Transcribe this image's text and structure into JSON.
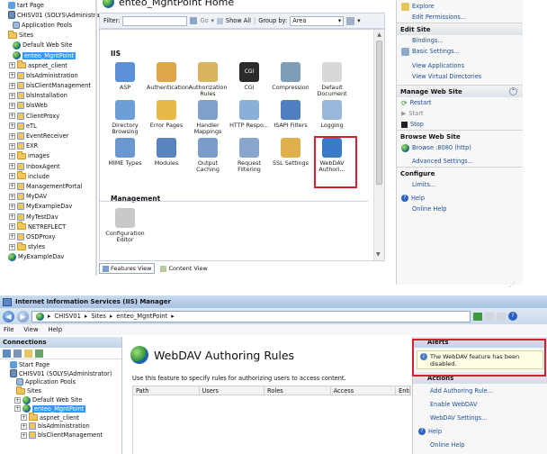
{
  "top_window": {
    "tree": [
      {
        "label": "tart Page",
        "depth": 0,
        "icon": "start-page-icon"
      },
      {
        "label": "CHISV01 (SOLYS\\Administrator)",
        "depth": 0,
        "icon": "server-icon"
      },
      {
        "label": "Application Pools",
        "depth": 1,
        "icon": "app-pools-icon"
      },
      {
        "label": "Sites",
        "depth": 0,
        "icon": "folder-icon"
      },
      {
        "label": "Default Web Site",
        "depth": 1,
        "icon": "globe-icon"
      },
      {
        "label": "enteo_MgntPoint",
        "depth": 1,
        "icon": "globe-icon",
        "selected": true
      },
      {
        "label": "aspnet_client",
        "depth": 2,
        "icon": "folder-icon"
      },
      {
        "label": "blsAdministration",
        "depth": 2,
        "icon": "app-icon"
      },
      {
        "label": "blsClientManagement",
        "depth": 2,
        "icon": "app-icon"
      },
      {
        "label": "blsInstallation",
        "depth": 2,
        "icon": "app-icon"
      },
      {
        "label": "blsWeb",
        "depth": 2,
        "icon": "app-icon"
      },
      {
        "label": "ClientProxy",
        "depth": 2,
        "icon": "app-icon"
      },
      {
        "label": "eTL",
        "depth": 2,
        "icon": "app-icon"
      },
      {
        "label": "EventReceiver",
        "depth": 2,
        "icon": "app-icon"
      },
      {
        "label": "EXR",
        "depth": 2,
        "icon": "app-icon"
      },
      {
        "label": "images",
        "depth": 2,
        "icon": "folder-icon"
      },
      {
        "label": "InboxAgent",
        "depth": 2,
        "icon": "app-icon"
      },
      {
        "label": "include",
        "depth": 2,
        "icon": "folder-icon"
      },
      {
        "label": "ManagementPortal",
        "depth": 2,
        "icon": "app-icon"
      },
      {
        "label": "MyDAV",
        "depth": 2,
        "icon": "app-icon"
      },
      {
        "label": "MyExampleDav",
        "depth": 2,
        "icon": "app-icon"
      },
      {
        "label": "MyTestDav",
        "depth": 2,
        "icon": "app-icon"
      },
      {
        "label": "NETREFLECT",
        "depth": 2,
        "icon": "folder-icon"
      },
      {
        "label": "OSDProxy",
        "depth": 2,
        "icon": "app-icon"
      },
      {
        "label": "styles",
        "depth": 2,
        "icon": "folder-icon"
      },
      {
        "label": "MyExampleDav",
        "depth": 0,
        "icon": "globe-icon"
      }
    ],
    "page_title": "enteo_MgntPoint Home",
    "filter_label": "Filter:",
    "go_label": "Go",
    "show_all_label": "Show All",
    "group_by_label": "Group by:",
    "group_by_value": "Area",
    "section_iis": "IIS",
    "section_management": "Management",
    "features": [
      {
        "label": "ASP",
        "icon": "asp-icon",
        "color": "#5b8fd6"
      },
      {
        "label": "Authentication",
        "icon": "authentication-icon",
        "color": "#e0a64a"
      },
      {
        "label": "Authorization Rules",
        "icon": "authorization-rules-icon",
        "color": "#d9b45e"
      },
      {
        "label": "CGI",
        "icon": "cgi-icon",
        "color": "#2b2b2b"
      },
      {
        "label": "Compression",
        "icon": "compression-icon",
        "color": "#7f9db9"
      },
      {
        "label": "Default Document",
        "icon": "default-document-icon",
        "color": "#d8d8d8"
      },
      {
        "label": "Directory Browsing",
        "icon": "directory-browsing-icon",
        "color": "#6d9ed8"
      },
      {
        "label": "Error Pages",
        "icon": "error-pages-icon",
        "color": "#e6b94a"
      },
      {
        "label": "Handler Mappings",
        "icon": "handler-mappings-icon",
        "color": "#7fa0c8"
      },
      {
        "label": "HTTP Respo...",
        "icon": "http-response-icon",
        "color": "#8bb0d8"
      },
      {
        "label": "ISAPI Filters",
        "icon": "isapi-filters-icon",
        "color": "#4f7fbe"
      },
      {
        "label": "Logging",
        "icon": "logging-icon",
        "color": "#9bb7dc"
      },
      {
        "label": "MIME Types",
        "icon": "mime-types-icon",
        "color": "#6b98cf"
      },
      {
        "label": "Modules",
        "icon": "modules-icon",
        "color": "#5a84bd"
      },
      {
        "label": "Output Caching",
        "icon": "output-caching-icon",
        "color": "#7c9ccc"
      },
      {
        "label": "Request Filtering",
        "icon": "request-filtering-icon",
        "color": "#8ba6cd"
      },
      {
        "label": "SSL Settings",
        "icon": "ssl-settings-icon",
        "color": "#e0b04c"
      },
      {
        "label": "WebDAV Authori...",
        "icon": "webdav-authoring-icon",
        "color": "#3a7bc8"
      }
    ],
    "management_features": [
      {
        "label": "Configuration Editor",
        "icon": "configuration-editor-icon",
        "color": "#c9c9c9"
      }
    ],
    "features_view_tab": "Features View",
    "content_view_tab": "Content View",
    "actions": {
      "explore": "Explore",
      "edit_permissions": "Edit Permissions...",
      "edit_site_header": "Edit Site",
      "bindings": "Bindings...",
      "basic_settings": "Basic Settings...",
      "view_applications": "View Applications",
      "view_virtual_directories": "View Virtual Directories",
      "manage_header": "Manage Web Site",
      "restart": "Restart",
      "start": "Start",
      "stop": "Stop",
      "browse_header": "Browse Web Site",
      "browse": "Browse :8080 (http)",
      "advanced_settings": "Advanced Settings...",
      "configure_header": "Configure",
      "limits": "Limits...",
      "help": "Help",
      "online_help": "Online Help"
    }
  },
  "bottom_window": {
    "title": "Internet Information Services (IIS) Manager",
    "breadcrumb": [
      "CHISV01",
      "Sites",
      "enteo_MgntPoint"
    ],
    "menu": [
      "File",
      "View",
      "Help"
    ],
    "connections_header": "Connections",
    "tree": [
      {
        "label": "Start Page",
        "depth": 0,
        "icon": "start-page-icon"
      },
      {
        "label": "CHISV01 (SOLYS\\Administrator)",
        "depth": 0,
        "icon": "server-icon"
      },
      {
        "label": "Application Pools",
        "depth": 1,
        "icon": "app-pools-icon"
      },
      {
        "label": "Sites",
        "depth": 1,
        "icon": "folder-icon"
      },
      {
        "label": "Default Web Site",
        "depth": 2,
        "icon": "globe-icon"
      },
      {
        "label": "enteo_MgntPoint",
        "depth": 2,
        "icon": "globe-icon",
        "selected": true
      },
      {
        "label": "aspnet_client",
        "depth": 3,
        "icon": "folder-icon"
      },
      {
        "label": "blsAdministration",
        "depth": 3,
        "icon": "app-icon"
      },
      {
        "label": "blsClientManagement",
        "depth": 3,
        "icon": "app-icon"
      }
    ],
    "page_title": "WebDAV Authoring Rules",
    "description": "Use this feature to specify rules for authorizing users to access content.",
    "columns": [
      "Path",
      "Users",
      "Roles",
      "Access",
      "Entr"
    ],
    "alerts_header": "Alerts",
    "alert_text": "The WebDAV feature has been disabled.",
    "actions_header": "Actions",
    "actions": [
      "Add Authoring Rule...",
      "Enable WebDAV",
      "WebDAV Settings...",
      "Help",
      "Online Help"
    ]
  }
}
